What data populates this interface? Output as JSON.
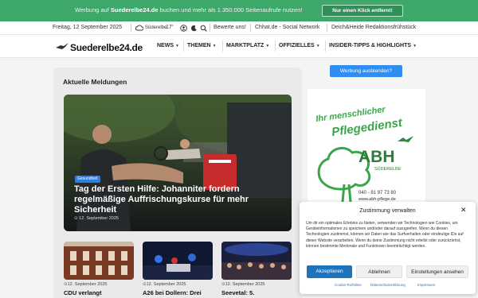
{
  "promo": {
    "text_pre": "Werbung auf ",
    "text_site": "Suederelbe24.de",
    "text_post": " buchen und mehr als 1.350.000 Seitenaufrufe nutzen!",
    "button": "Nur einen Klick entfernt!"
  },
  "topbar": {
    "date": "Freitag, 12 September 2025",
    "weather_place": "Süderelbe",
    "weather_temp": "17",
    "weather_unit": "°",
    "rate": "Bewerte uns!",
    "chhat": "Chhat.de - Social Network",
    "deichheide": "Deich&Heide Redaktionsfrühstück"
  },
  "nav": {
    "logo": "Suederelbe24.de",
    "items": [
      "NEWS",
      "THEMEN",
      "MARKTPLATZ",
      "OFFIZIELLES",
      "INSIDER-TIPPS & HIGHLIGHTS"
    ]
  },
  "main": {
    "section_title": "Aktuelle Meldungen",
    "hero": {
      "category": "Gesundheit",
      "title": "Tag der Ersten Hilfe: Johanniter fordern regelmäßige Auffrischungskurse für mehr Sicherheit",
      "date": "12. September 2025"
    },
    "cards": [
      {
        "date": "12. September 2025",
        "title": "CDU verlangt"
      },
      {
        "date": "12. September 2025",
        "title": "A26 bei Dollern: Drei"
      },
      {
        "date": "12. September 2025",
        "title": "Seevetal: 5."
      }
    ]
  },
  "sidebar": {
    "ad_button": "Werbung ausblenden?",
    "ad": {
      "slogan_1": "Ihr menschlicher",
      "slogan_2": "Pflegedienst",
      "brand": "ABH",
      "brand_sub": "SÜDERELBE",
      "phone": "040 - 81 97 73 80",
      "url": "www.abh-pflege.de"
    }
  },
  "consent": {
    "title": "Zustimmung verwalten",
    "body": "Um dir ein optimales Erlebnis zu bieten, verwenden wir Technologien wie Cookies, um Geräteinformationen zu speichern und/oder darauf zuzugreifen. Wenn du diesen Technologien zustimmst, können wir Daten wie das Surfverhalten oder eindeutige IDs auf dieser Website verarbeiten. Wenn du deine Zustimmung nicht erteilst oder zurückziehst, können bestimmte Merkmale und Funktionen beeinträchtigt werden.",
    "accept": "Akzeptieren",
    "deny": "Ablehnen",
    "settings": "Einstellungen ansehen",
    "links": [
      "Cookie-Richtlinie",
      "Datenschutzerklärung",
      "Impressum"
    ]
  },
  "colors": {
    "promo_green": "#3ea86a",
    "accent_blue": "#2f8ef0",
    "ad_green": "#3aa64a"
  }
}
